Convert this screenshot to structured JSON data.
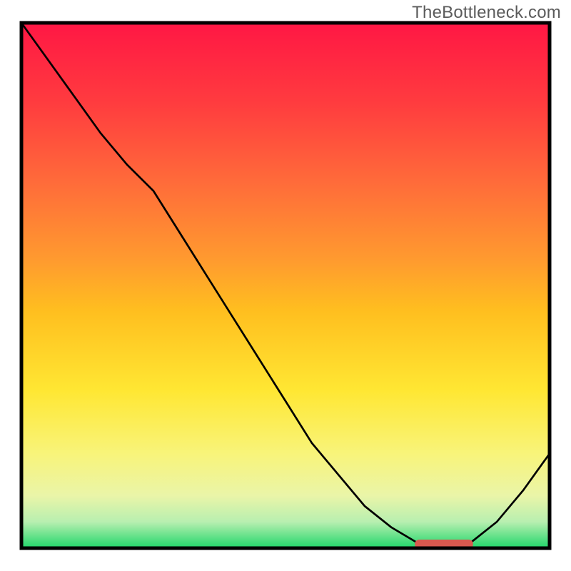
{
  "watermark": "TheBottleneck.com",
  "chart_data": {
    "type": "line",
    "x": [
      0.0,
      0.05,
      0.1,
      0.15,
      0.2,
      0.25,
      0.3,
      0.35,
      0.4,
      0.45,
      0.5,
      0.55,
      0.6,
      0.65,
      0.7,
      0.75,
      0.78,
      0.8,
      0.83,
      0.85,
      0.9,
      0.95,
      1.0
    ],
    "values": [
      1.0,
      0.93,
      0.86,
      0.79,
      0.73,
      0.68,
      0.6,
      0.52,
      0.44,
      0.36,
      0.28,
      0.2,
      0.14,
      0.08,
      0.04,
      0.01,
      0.0,
      0.0,
      0.0,
      0.01,
      0.05,
      0.11,
      0.18
    ],
    "title": "",
    "xlabel": "",
    "ylabel": "",
    "xlim": [
      0,
      1
    ],
    "ylim": [
      0,
      1
    ],
    "background_gradient": {
      "stops": [
        {
          "offset": 0.0,
          "color": "#ff1744"
        },
        {
          "offset": 0.15,
          "color": "#ff3b3f"
        },
        {
          "offset": 0.3,
          "color": "#ff6a3a"
        },
        {
          "offset": 0.45,
          "color": "#ff9a2f"
        },
        {
          "offset": 0.55,
          "color": "#ffbf1f"
        },
        {
          "offset": 0.7,
          "color": "#ffe733"
        },
        {
          "offset": 0.82,
          "color": "#f8f47a"
        },
        {
          "offset": 0.9,
          "color": "#eaf5a8"
        },
        {
          "offset": 0.95,
          "color": "#b8efb0"
        },
        {
          "offset": 1.0,
          "color": "#1fd66a"
        }
      ]
    },
    "marker_bar": {
      "x0": 0.745,
      "x1": 0.855,
      "y": 0.0,
      "color": "#d9594f"
    },
    "frame_color": "#000000",
    "line_color": "#000000"
  }
}
